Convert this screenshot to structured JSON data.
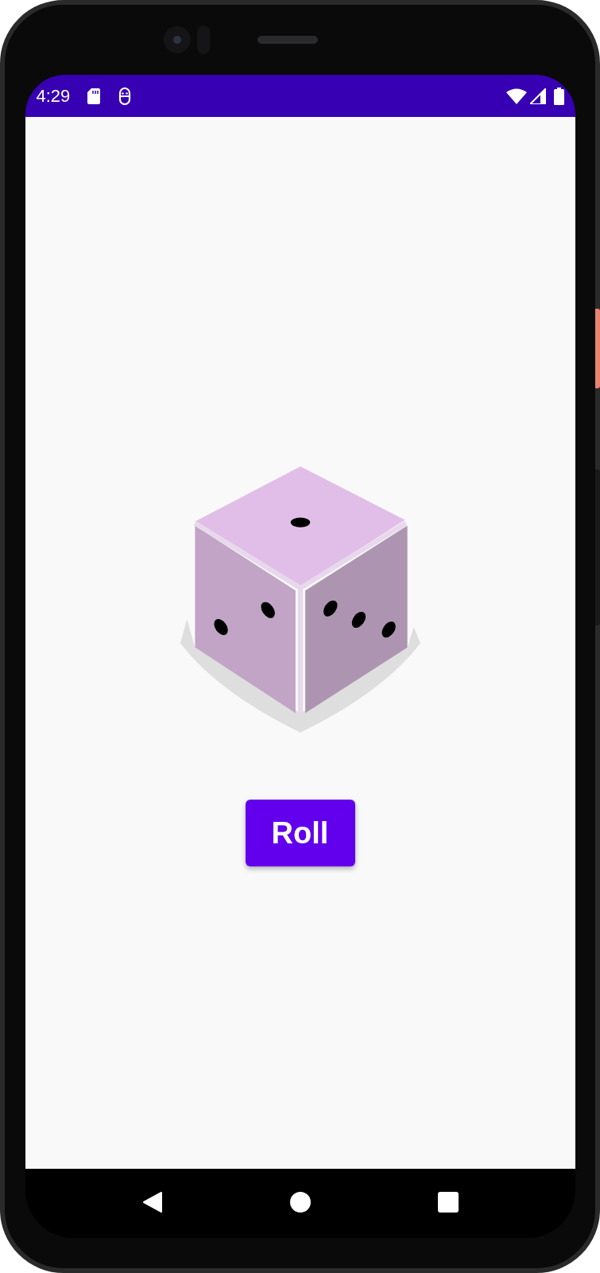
{
  "status_bar": {
    "time": "4:29"
  },
  "roll_button": {
    "label": "Roll"
  }
}
